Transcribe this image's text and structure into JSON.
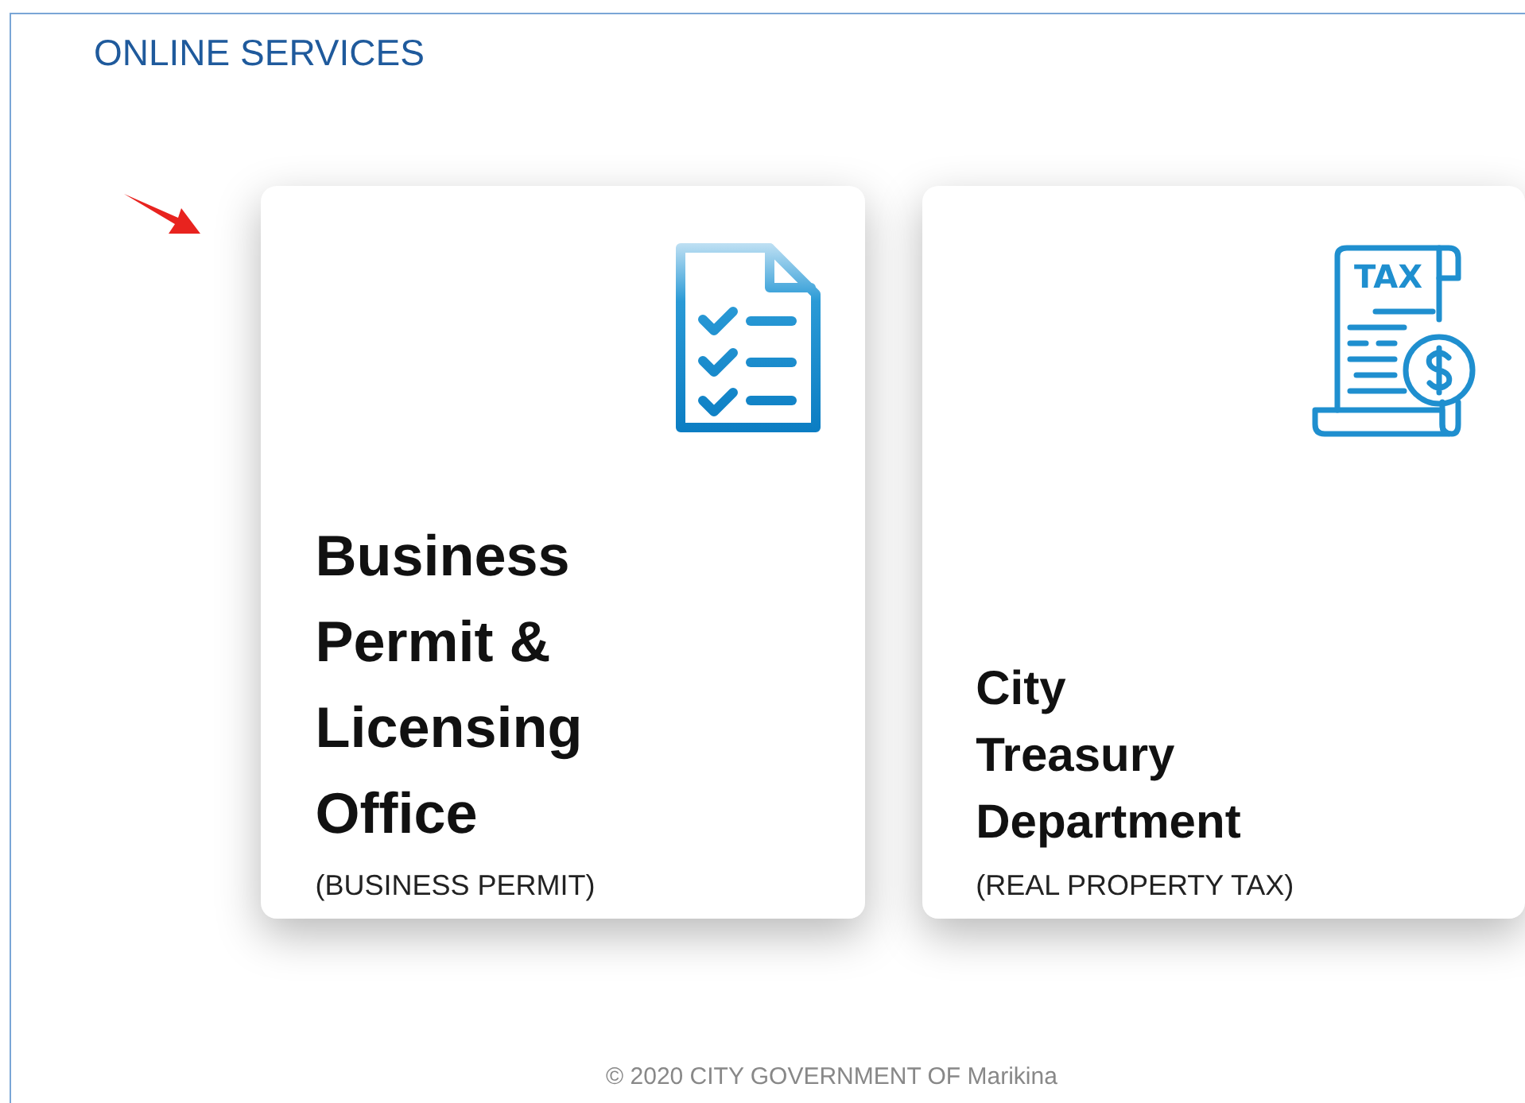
{
  "section": {
    "title": "ONLINE SERVICES"
  },
  "cards": [
    {
      "kind": "checklist",
      "title_lines": [
        "Business",
        "Permit &",
        "Licensing",
        "Office"
      ],
      "subtitle": "(BUSINESS PERMIT)"
    },
    {
      "kind": "tax",
      "icon_text": "TAX",
      "title_lines": [
        "City",
        "Treasury",
        "Department"
      ],
      "subtitle": "(REAL PROPERTY TAX)"
    }
  ],
  "footer": "© 2020 CITY GOVERNMENT OF Marikina"
}
